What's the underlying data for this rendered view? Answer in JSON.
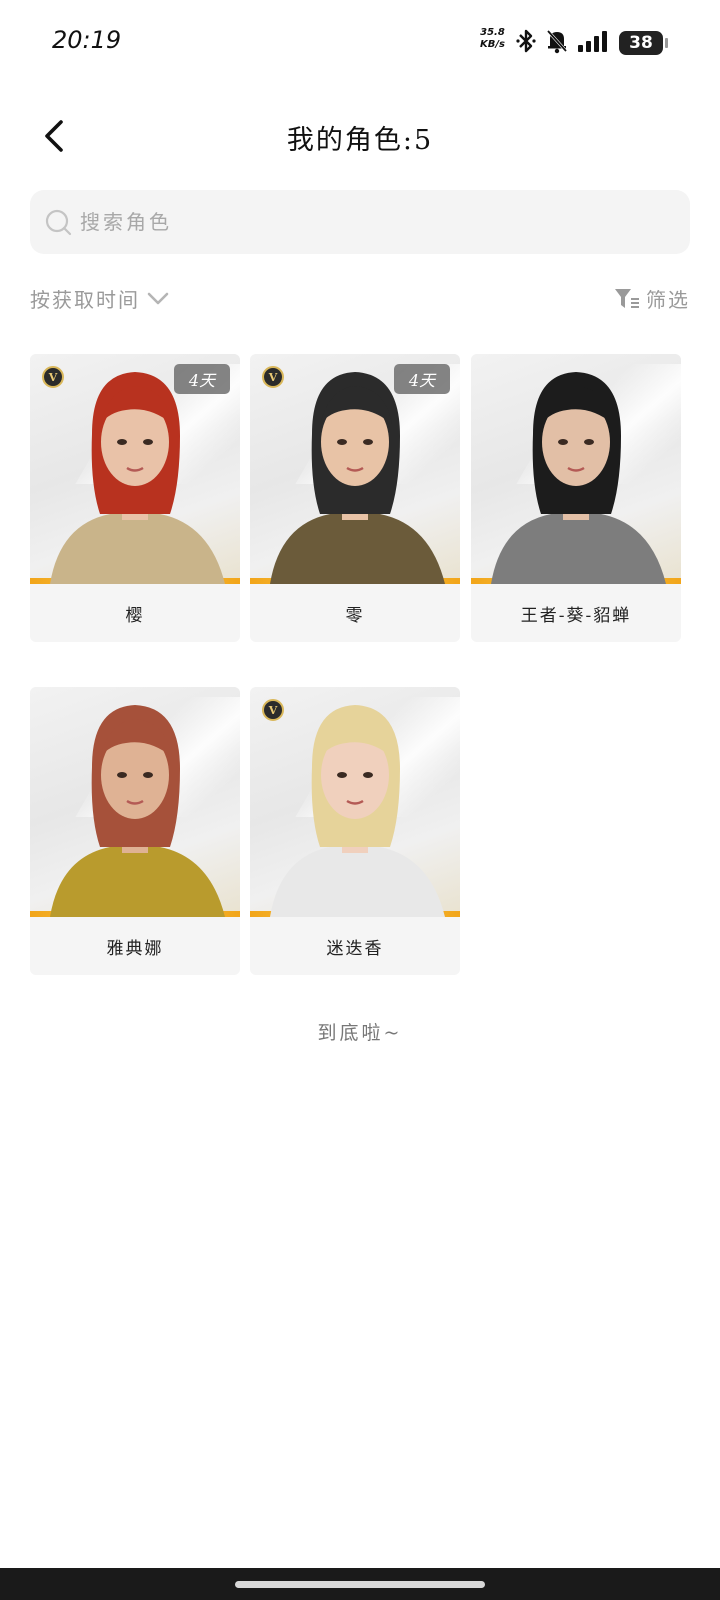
{
  "status_bar": {
    "time": "20:19",
    "net_speed_value": "35.8",
    "net_speed_unit": "KB/s",
    "battery": "38",
    "icons": [
      "bluetooth-icon",
      "bell-off-icon",
      "signal-icon",
      "battery-icon"
    ]
  },
  "header": {
    "back_icon": "chevron-left-icon",
    "title": "我的角色:5"
  },
  "search": {
    "placeholder": "搜索角色",
    "value": ""
  },
  "sort": {
    "label": "按获取时间"
  },
  "filter": {
    "label": "筛选"
  },
  "characters": [
    {
      "name": "樱",
      "vip": true,
      "vip_label": "V",
      "days": "4天",
      "hair": "#b8321f",
      "skin": "#e9c2a8",
      "outfit": "#c9b48a"
    },
    {
      "name": "零",
      "vip": true,
      "vip_label": "V",
      "days": "4天",
      "hair": "#2b2b2b",
      "skin": "#e8c3a6",
      "outfit": "#6b5b3a"
    },
    {
      "name": "王者-葵-貂蝉",
      "vip": false,
      "vip_label": "",
      "days": "",
      "hair": "#1c1c1c",
      "skin": "#e2bfa6",
      "outfit": "#7d7d7d"
    },
    {
      "name": "雅典娜",
      "vip": false,
      "vip_label": "",
      "days": "",
      "hair": "#a6513a",
      "skin": "#dfb294",
      "outfit": "#b99b2d"
    },
    {
      "name": "迷迭香",
      "vip": true,
      "vip_label": "V",
      "days": "",
      "hair": "#e6d39a",
      "skin": "#f0d0bd",
      "outfit": "#e8e8e8"
    }
  ],
  "footer": {
    "end_text": "到底啦~"
  },
  "colors": {
    "card_accent": "#f2a51a",
    "vip_gold": "#d9b75a"
  }
}
